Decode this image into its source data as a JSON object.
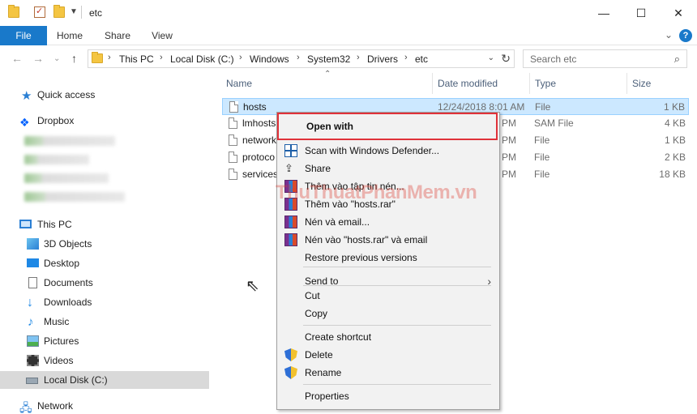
{
  "window": {
    "title": "etc",
    "controls": {
      "minimize": "—",
      "maximize": "☐",
      "close": "✕"
    }
  },
  "ribbon": {
    "tabs": [
      "File",
      "Home",
      "Share",
      "View"
    ],
    "expand_glyph": "⌄",
    "help_glyph": "?"
  },
  "address": {
    "crumbs": [
      "This PC",
      "Local Disk (C:)",
      "Windows",
      "System32",
      "Drivers",
      "etc"
    ],
    "separator": "›",
    "dropdown_glyph": "⌄",
    "refresh_glyph": "↻"
  },
  "search": {
    "placeholder": "Search etc",
    "icon": "search-icon"
  },
  "sidebar": {
    "quick_access": "Quick access",
    "dropbox": "Dropbox",
    "this_pc": "This PC",
    "items": [
      {
        "label": "3D Objects",
        "icon": "cube-icon"
      },
      {
        "label": "Desktop",
        "icon": "desktop-icon"
      },
      {
        "label": "Documents",
        "icon": "documents-icon"
      },
      {
        "label": "Downloads",
        "icon": "download-icon"
      },
      {
        "label": "Music",
        "icon": "music-icon"
      },
      {
        "label": "Pictures",
        "icon": "pictures-icon"
      },
      {
        "label": "Videos",
        "icon": "videos-icon"
      },
      {
        "label": "Local Disk (C:)",
        "icon": "drive-icon"
      }
    ],
    "network": "Network"
  },
  "columns": {
    "name": "Name",
    "date": "Date modified",
    "type": "Type",
    "size": "Size"
  },
  "files": [
    {
      "name": "hosts",
      "date": "12/24/2018 8:01 AM",
      "type": "File",
      "size": "1 KB"
    },
    {
      "name": "lmhosts",
      "date": "PM",
      "type": "SAM File",
      "size": "4 KB"
    },
    {
      "name": "network",
      "date": "PM",
      "type": "File",
      "size": "1 KB"
    },
    {
      "name": "protoco",
      "date": "PM",
      "type": "File",
      "size": "2 KB"
    },
    {
      "name": "services",
      "date": "PM",
      "type": "File",
      "size": "18 KB"
    }
  ],
  "watermark": "ThuThuatPhanMem.vn",
  "context_menu": {
    "open_with": "Open with",
    "scan": "Scan with Windows Defender...",
    "share": "Share",
    "add_archive": "Thêm vào tập tin nén...",
    "add_hosts_rar": "Thêm vào \"hosts.rar\"",
    "compress_email": "Nén và email...",
    "compress_hosts_email": "Nén vào \"hosts.rar\" và email",
    "restore": "Restore previous versions",
    "send_to": "Send to",
    "cut": "Cut",
    "copy": "Copy",
    "create_shortcut": "Create shortcut",
    "delete": "Delete",
    "rename": "Rename",
    "properties": "Properties"
  },
  "colors": {
    "accent": "#1979ca",
    "selection": "#cce8ff",
    "highlight_border": "#e0323a"
  }
}
